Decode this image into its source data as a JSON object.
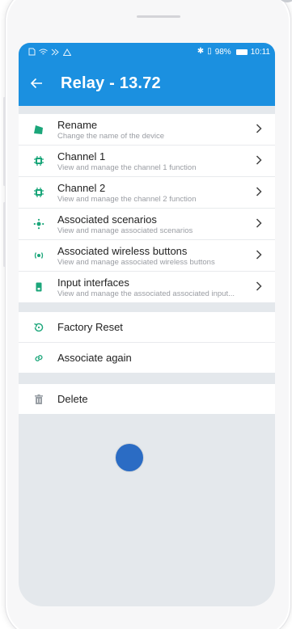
{
  "status_bar": {
    "left_icons": [
      "sim-icon",
      "wifi-icon",
      "cast-icon",
      "warning-icon"
    ],
    "battery": "98%",
    "time": "10:11"
  },
  "app_bar": {
    "back_icon": "arrow-left-icon",
    "title": "Relay - 13.72"
  },
  "menu": [
    {
      "icon": "rename-icon",
      "label": "Rename",
      "description": "Change the name of the device"
    },
    {
      "icon": "chip-icon",
      "label": "Channel 1",
      "description": "View and manage the channel 1 function"
    },
    {
      "icon": "chip-icon",
      "label": "Channel 2",
      "description": "View and manage the channel 2 function"
    },
    {
      "icon": "scenario-icon",
      "label": "Associated scenarios",
      "description": "View and manage associated scenarios"
    },
    {
      "icon": "wireless-icon",
      "label": "Associated wireless buttons",
      "description": "View and manage associated wireless buttons"
    },
    {
      "icon": "input-icon",
      "label": "Input interfaces",
      "description": "View and manage the associated associated input..."
    }
  ],
  "actions": [
    {
      "icon": "reset-icon",
      "label": "Factory Reset"
    },
    {
      "icon": "link-icon",
      "label": "Associate again"
    }
  ],
  "danger": {
    "icon": "trash-icon",
    "label": "Delete"
  },
  "colors": {
    "brand": "#1b90e0",
    "icon_green": "#1ba67a",
    "delete_icon": "#9aa0a6",
    "touch_indicator": "#2b6cc4"
  }
}
